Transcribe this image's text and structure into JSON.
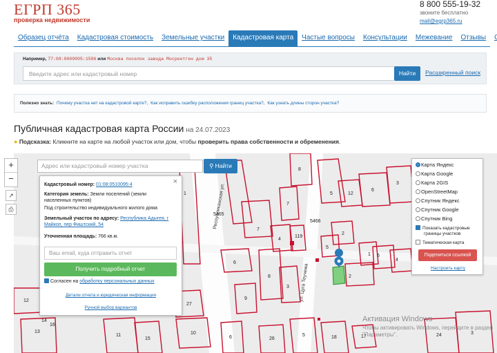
{
  "header": {
    "logo_title": "ЕГРП 365",
    "logo_subtitle": "проверка недвижимости",
    "phone": "8 800 555-19-32",
    "phone_note": "звоните бесплатно",
    "email": "mail@egrp365.ru"
  },
  "nav": {
    "items": [
      {
        "label": "Образец отчёта"
      },
      {
        "label": "Кадастровая стоимость"
      },
      {
        "label": "Земельные участки"
      },
      {
        "label": "Кадастровая карта"
      },
      {
        "label": "Частые вопросы"
      },
      {
        "label": "Консультации"
      },
      {
        "label": "Межевание"
      },
      {
        "label": "Отзывы"
      },
      {
        "label": "О нас"
      }
    ],
    "active_index": 3
  },
  "search": {
    "example_prefix": "Например,",
    "example_code": "77:08:0009005:1596",
    "example_or": "или",
    "example_address": "Москва поселок завода Мосрентген дом 35",
    "placeholder": "Введите адрес или кадастровый номер",
    "find_label": "Найти",
    "advanced_label": "Расширенный поиск"
  },
  "useful": {
    "label": "Полезно знать:",
    "links": [
      "Почему участка нет на кадастровой карте?",
      "Как исправить ошибку расположения границ участка?",
      "Как узнать длины сторон участка?"
    ]
  },
  "page": {
    "title": "Публичная кадастровая карта России",
    "date": "на 24.07.2023",
    "hint_label": "Подсказка:",
    "hint_text": "Кликните на карте на любой участок или дом, чтобы",
    "hint_bold": "проверить права собственности и обременения",
    "hint_end": "."
  },
  "map": {
    "zoom_in": "+",
    "zoom_out": "−",
    "search_placeholder": "Адрес или кадастровый номер участка",
    "find_label": "Найти",
    "street_1": "Республиканская ул.",
    "street_2": "ул. Цуга Теучежа",
    "parcel_labels": [
      "5465",
      "5466",
      "7",
      "6",
      "8",
      "3",
      "4",
      "119",
      "5",
      "2",
      "2",
      "1",
      "12",
      "13",
      "14",
      "16",
      "1",
      "6",
      "4",
      "5",
      "12",
      "6",
      "3",
      "27",
      "10",
      "11",
      "15",
      "5",
      "18",
      "17",
      "24",
      "3",
      "26",
      "6",
      "7",
      "8",
      "9"
    ]
  },
  "popup": {
    "cad_label": "Кадастровый номер:",
    "cad_value": "01:08:0510095:4",
    "category_label": "Категория земель:",
    "category_value": "Земли поселений (земли населенных пунктов)",
    "usage": "Под строительство индивидуального жилого дома",
    "address_label": "Земельный участок по адресу:",
    "address_value": "Республика Адыгея, г Майкоп, пер Фиштский, 54",
    "area_label": "Уточненная площадь:",
    "area_value": "766 кв.м.",
    "email_placeholder": "Ваш email, куда отправить отчет",
    "order_button": "Получить подробный отчет",
    "agree_prefix": "Согласен на",
    "agree_link": "обработку персональных данных",
    "details_link": "Детали отчета и юридическая информация",
    "manual_link": "Ручной выбор вариантов"
  },
  "layers": {
    "options": [
      "Карта Яндекс",
      "Карта Google",
      "Карта 2GIS",
      "OpenStreetMap",
      "Спутник Яндекс",
      "Спутник Google",
      "Спутник Bing"
    ],
    "selected_index": 0,
    "show_borders": "Показать кадастровые границы участков",
    "thematic": "Тематическая карта",
    "share_button": "Поделиться ссылкой",
    "setup_link": "Настроить карту"
  },
  "windows": {
    "title": "Активация Windows",
    "text": "Чтобы активировать Windows, перейдите в раздел \"Параметры\"."
  },
  "colors": {
    "brand_red": "#c0392b",
    "accent_blue": "#2a7ab8",
    "parcel_red": "#c8102e",
    "green_button": "#5cb85c",
    "share_red": "#d9534f"
  }
}
